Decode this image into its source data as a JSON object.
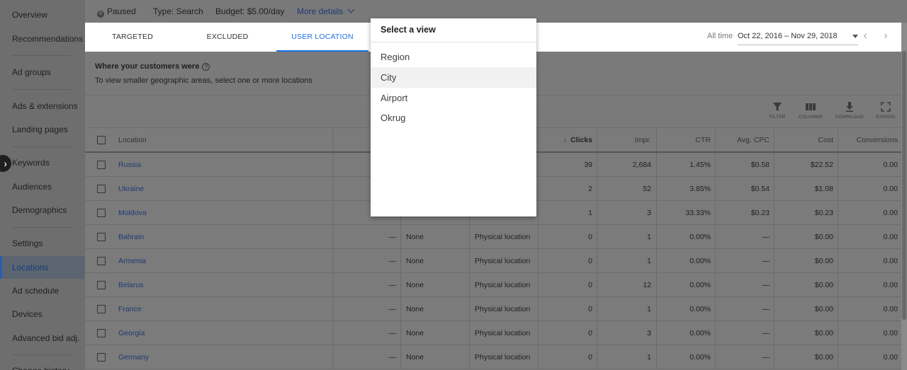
{
  "sidebar": {
    "items": [
      {
        "label": "Overview"
      },
      {
        "label": "Recommendations"
      },
      {
        "label": "Ad groups"
      },
      {
        "label": "Ads & extensions"
      },
      {
        "label": "Landing pages"
      },
      {
        "label": "Keywords"
      },
      {
        "label": "Audiences"
      },
      {
        "label": "Demographics"
      },
      {
        "label": "Settings"
      },
      {
        "label": "Locations"
      },
      {
        "label": "Ad schedule"
      },
      {
        "label": "Devices"
      },
      {
        "label": "Advanced bid adj."
      },
      {
        "label": "Change history"
      }
    ],
    "active": "Locations"
  },
  "topbar": {
    "status": "Paused",
    "type": "Type: Search",
    "budget": "Budget: $5.00/day",
    "more_details": "More details"
  },
  "tabs": [
    {
      "label": "TARGETED"
    },
    {
      "label": "EXCLUDED"
    },
    {
      "label": "USER LOCATION REPORT"
    }
  ],
  "date": {
    "label": "All time",
    "range": "Oct 22, 2016 – Nov 29, 2018"
  },
  "info": {
    "title": "Where your customers were",
    "subtitle": "To view smaller geographic areas, select one or more locations"
  },
  "toolbar": {
    "filter": "FILTER",
    "columns": "COLUMNS",
    "download": "DOWNLOAD",
    "expand": "EXPAND"
  },
  "table": {
    "headers": {
      "location": "Location",
      "clicks": "Clicks",
      "impr": "Impr.",
      "ctr": "CTR",
      "avg_cpc": "Avg. CPC",
      "cost": "Cost",
      "conversions": "Conversions"
    },
    "rows": [
      {
        "location": "Russia",
        "col2": "",
        "col3": "",
        "col4": "",
        "clicks": "39",
        "impr": "2,684",
        "ctr": "1.45%",
        "cpc": "$0.58",
        "cost": "$22.52",
        "conv": "0.00"
      },
      {
        "location": "Ukraine",
        "col2": "",
        "col3": "",
        "col4": "",
        "clicks": "2",
        "impr": "52",
        "ctr": "3.85%",
        "cpc": "$0.54",
        "cost": "$1.08",
        "conv": "0.00"
      },
      {
        "location": "Moldova",
        "col2": "",
        "col3": "",
        "col4": "",
        "clicks": "1",
        "impr": "3",
        "ctr": "33.33%",
        "cpc": "$0.23",
        "cost": "$0.23",
        "conv": "0.00"
      },
      {
        "location": "Bahrain",
        "col2": "—",
        "col3": "None",
        "col4": "Physical location",
        "clicks": "0",
        "impr": "1",
        "ctr": "0.00%",
        "cpc": "—",
        "cost": "$0.00",
        "conv": "0.00"
      },
      {
        "location": "Armenia",
        "col2": "—",
        "col3": "None",
        "col4": "Physical location",
        "clicks": "0",
        "impr": "1",
        "ctr": "0.00%",
        "cpc": "—",
        "cost": "$0.00",
        "conv": "0.00"
      },
      {
        "location": "Belarus",
        "col2": "—",
        "col3": "None",
        "col4": "Physical location",
        "clicks": "0",
        "impr": "12",
        "ctr": "0.00%",
        "cpc": "—",
        "cost": "$0.00",
        "conv": "0.00"
      },
      {
        "location": "France",
        "col2": "—",
        "col3": "None",
        "col4": "Physical location",
        "clicks": "0",
        "impr": "1",
        "ctr": "0.00%",
        "cpc": "—",
        "cost": "$0.00",
        "conv": "0.00"
      },
      {
        "location": "Georgia",
        "col2": "—",
        "col3": "None",
        "col4": "Physical location",
        "clicks": "0",
        "impr": "3",
        "ctr": "0.00%",
        "cpc": "—",
        "cost": "$0.00",
        "conv": "0.00"
      },
      {
        "location": "Germany",
        "col2": "—",
        "col3": "None",
        "col4": "Physical location",
        "clicks": "0",
        "impr": "1",
        "ctr": "0.00%",
        "cpc": "—",
        "cost": "$0.00",
        "conv": "0.00"
      }
    ]
  },
  "popup": {
    "title": "Select a view",
    "options": [
      "Region",
      "City",
      "Airport",
      "Okrug"
    ],
    "hovered": "City"
  }
}
